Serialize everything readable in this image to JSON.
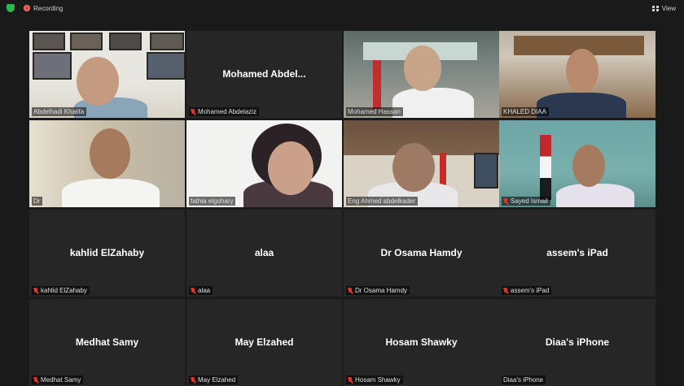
{
  "topbar": {
    "recording_label": "Recording",
    "view_label": "View"
  },
  "tiles": [
    {
      "name": "",
      "label": "Abdelhadi Khalifa",
      "muted": false
    },
    {
      "name": "Mohamed  Abdel...",
      "label": "Mohamed Abdelaziz",
      "muted": true
    },
    {
      "name": "",
      "label": "Mohamed Hassan",
      "muted": false
    },
    {
      "name": "",
      "label": "KHALED DIAA",
      "muted": false,
      "speaking": true
    },
    {
      "name": "",
      "label": "Dr",
      "muted": false
    },
    {
      "name": "",
      "label": "fathia elgohary",
      "muted": false
    },
    {
      "name": "",
      "label": "Eng Ahmed abdelkader",
      "muted": false
    },
    {
      "name": "",
      "label": "Sayed Ismail",
      "muted": true
    },
    {
      "name": "kahlid ElZahaby",
      "label": "kahlid ElZahaby",
      "muted": true
    },
    {
      "name": "alaa",
      "label": "alaa",
      "muted": true
    },
    {
      "name": "Dr Osama Hamdy",
      "label": "Dr Osama Hamdy",
      "muted": true
    },
    {
      "name": "assem's iPad",
      "label": "assem's iPad",
      "muted": true
    },
    {
      "name": "Medhat Samy",
      "label": "Medhat Samy",
      "muted": true
    },
    {
      "name": "May Elzahed",
      "label": "May Elzahed",
      "muted": true
    },
    {
      "name": "Hosam Shawky",
      "label": "Hosam Shawky",
      "muted": true
    },
    {
      "name": "Diaa's iPhone",
      "label": "Diaa's iPhone",
      "muted": false
    }
  ],
  "colors": {
    "background": "#1a1a1a",
    "tile": "#262626",
    "active_speaker": "#c4d52a",
    "mute": "#e0342a",
    "recording": "#e8483a",
    "security": "#2eb84b"
  },
  "icons": {
    "security": "shield-icon",
    "recording": "record-icon",
    "view": "grid-view-icon",
    "muted": "mic-muted-icon"
  }
}
